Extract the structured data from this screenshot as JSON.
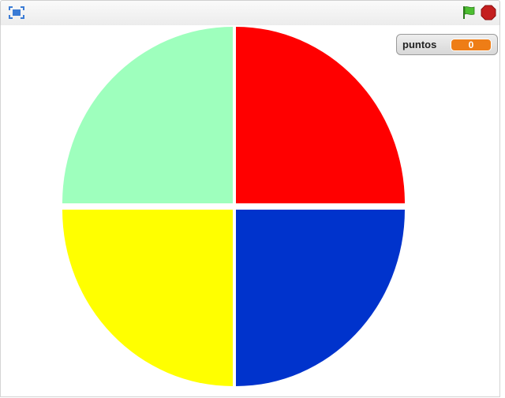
{
  "toolbar": {
    "fullscreen_icon": "fullscreen-icon",
    "green_flag_icon": "green-flag-icon",
    "stop_icon": "stop-sign-icon",
    "flag_color": "#4cbf30",
    "stop_color": "#c41f1f"
  },
  "stage": {
    "background": "#ffffff",
    "quadrants": [
      {
        "name": "top-left",
        "color": "#9effbd"
      },
      {
        "name": "top-right",
        "color": "#ff0000"
      },
      {
        "name": "bottom-left",
        "color": "#ffff00"
      },
      {
        "name": "bottom-right",
        "color": "#0033cc"
      }
    ],
    "watcher": {
      "label": "puntos",
      "value": "0",
      "value_color": "#ee7d16"
    }
  }
}
